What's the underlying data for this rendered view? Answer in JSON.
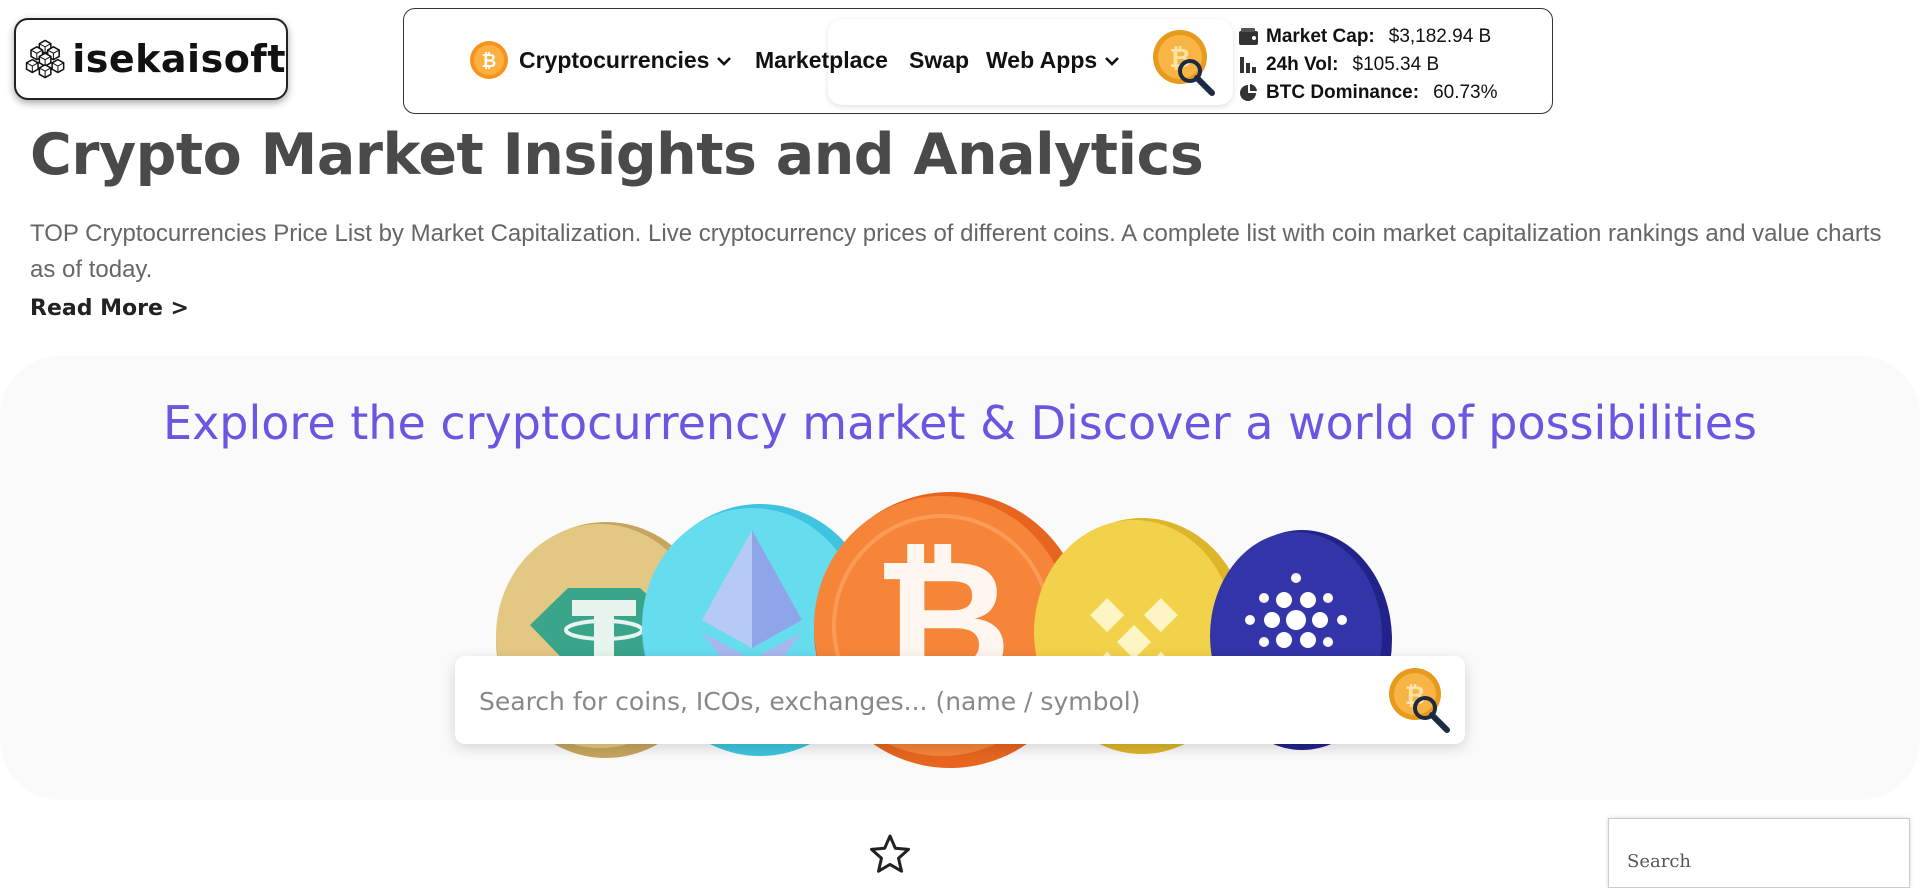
{
  "brand": {
    "name": "isekaisoft"
  },
  "nav": {
    "items": [
      {
        "label": "Cryptocurrencies",
        "has_dropdown": true
      },
      {
        "label": "Marketplace",
        "has_dropdown": false
      },
      {
        "label": "Swap",
        "has_dropdown": false
      },
      {
        "label": "Web Apps",
        "has_dropdown": true
      }
    ],
    "icons": [
      "bitcoin-coin-icon",
      "coin-search-icon",
      "chevron-down-icon"
    ]
  },
  "stats": [
    {
      "icon": "wallet-icon",
      "label": "Market Cap:",
      "value": "$3,182.94 B"
    },
    {
      "icon": "bar-chart-icon",
      "label": "24h Vol:",
      "value": "$105.34 B"
    },
    {
      "icon": "pie-chart-icon",
      "label": "BTC Dominance:",
      "value": "60.73%"
    }
  ],
  "header": {
    "title": "Crypto Market Insights and Analytics",
    "description": "TOP Cryptocurrencies Price List by Market Capitalization. Live cryptocurrency prices of different coins. A complete list with coin market capitalization rankings and value charts as of today.",
    "read_more": "Read More >"
  },
  "hero": {
    "title": "Explore the cryptocurrency market & Discover a world of possibilities",
    "coins": [
      "tether-coin-icon",
      "ethereum-coin-icon",
      "bitcoin-coin-icon",
      "binance-coin-icon",
      "cardano-coin-icon"
    ],
    "search_placeholder": "Search for coins, ICOs, exchanges... (name / symbol)"
  },
  "side_search": {
    "placeholder": "Search"
  },
  "colors": {
    "accent": "#6c55e0",
    "bitcoin_orange": "#f7931a",
    "title_gray": "#4a4a4a",
    "text_gray": "#666666"
  }
}
